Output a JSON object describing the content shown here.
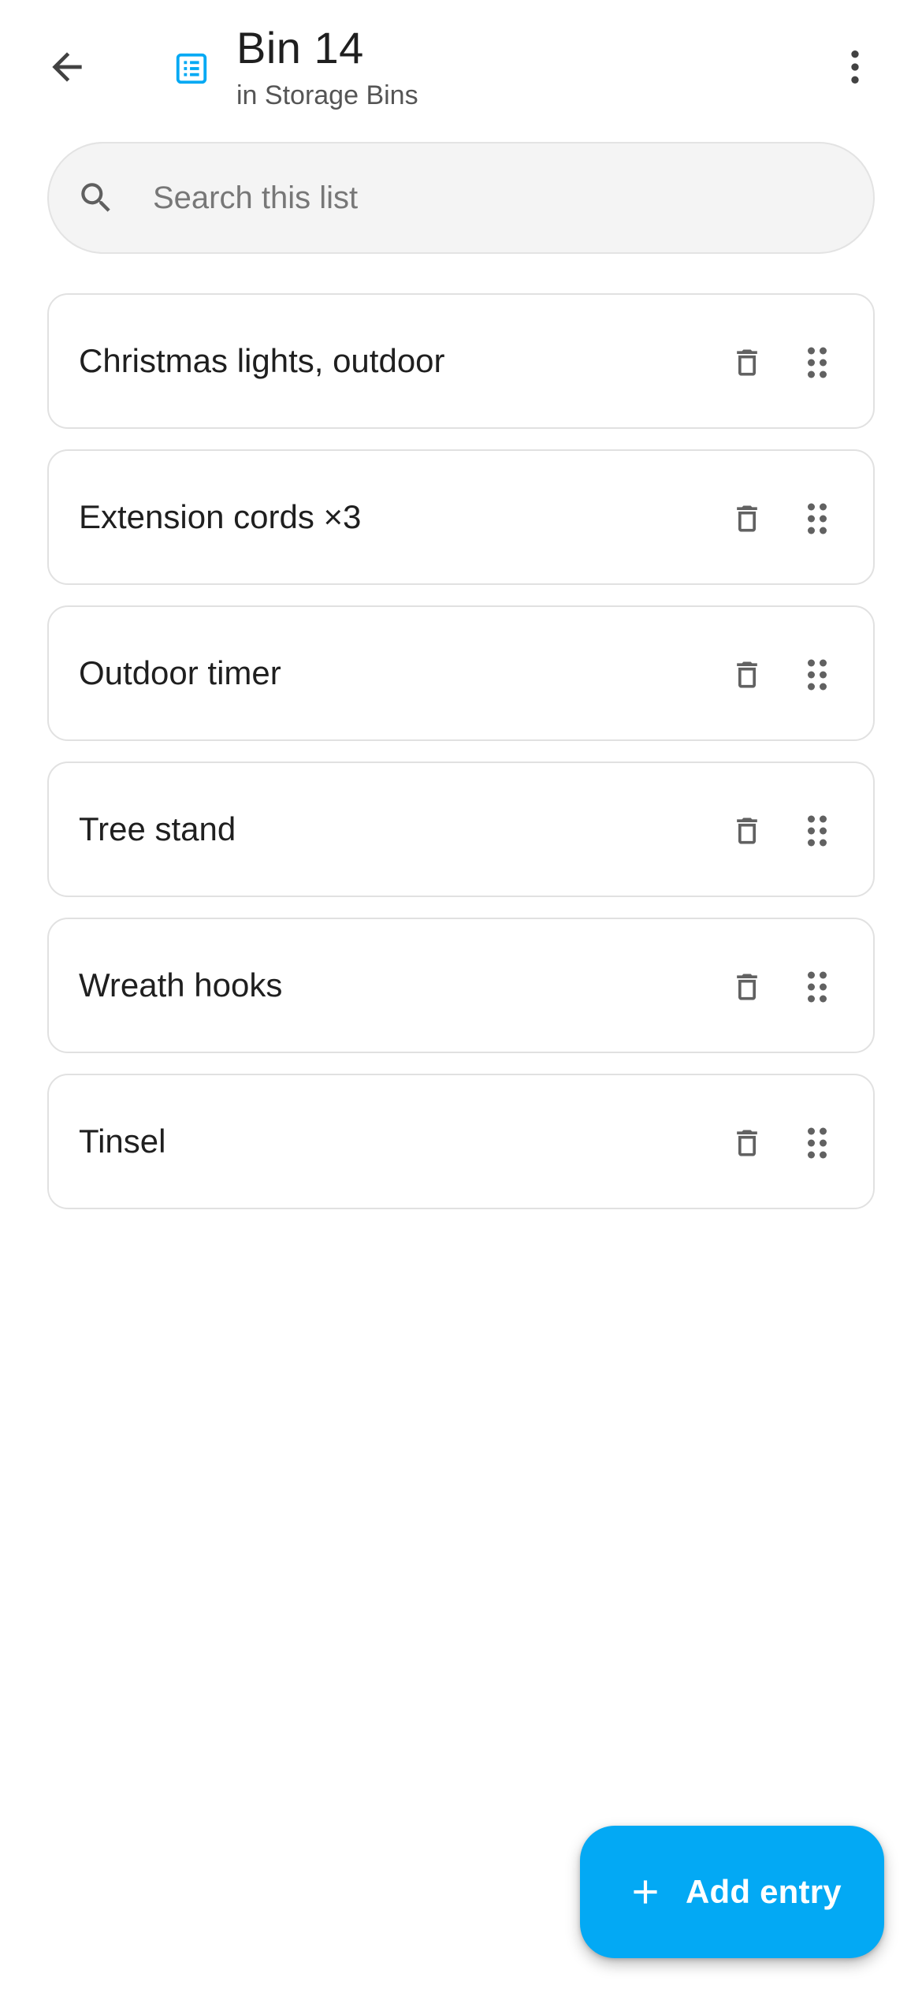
{
  "header": {
    "title": "Bin 14",
    "subtitle": "in Storage Bins",
    "back_icon": "arrow-left-icon",
    "list_icon": "list-box-icon",
    "menu_icon": "more-vert-icon"
  },
  "search": {
    "placeholder": "Search this list",
    "value": "",
    "icon": "search-icon"
  },
  "items": [
    {
      "label": "Christmas lights, outdoor"
    },
    {
      "label": "Extension cords ×3"
    },
    {
      "label": "Outdoor timer"
    },
    {
      "label": "Tree stand"
    },
    {
      "label": "Wreath hooks"
    },
    {
      "label": "Tinsel"
    }
  ],
  "item_actions": {
    "delete_icon": "trash-icon",
    "drag_icon": "drag-handle-icon"
  },
  "fab": {
    "label": "Add entry",
    "icon": "plus-icon"
  },
  "colors": {
    "accent": "#03a9f4",
    "icon_gray": "#616161",
    "card_border": "#e1e1e1"
  }
}
